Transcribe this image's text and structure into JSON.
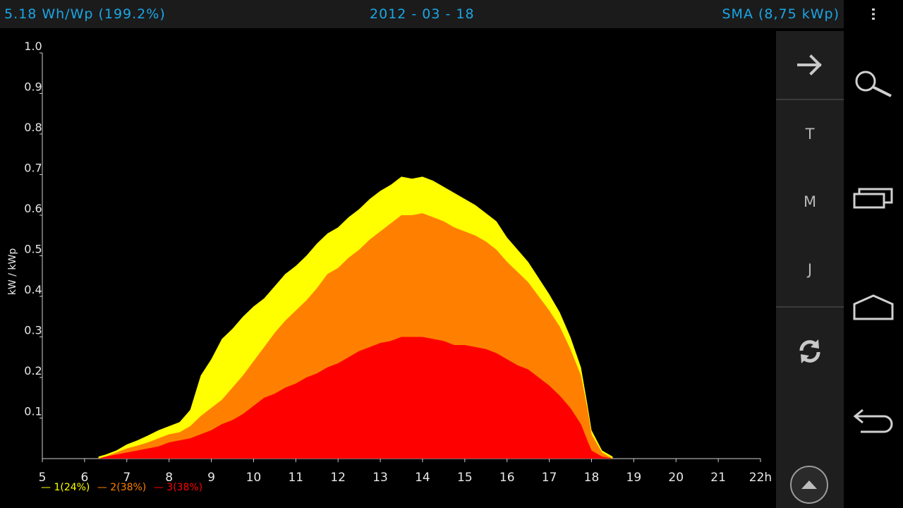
{
  "header": {
    "yield": "5.18 Wh/Wp (199.2%)",
    "date": "2012 - 03 - 18",
    "system": "SMA (8,75 kWp)"
  },
  "toolbar": {
    "forward_icon": "arrow-right-icon",
    "day_label": "T",
    "month_label": "M",
    "year_label": "J",
    "refresh_icon": "refresh-icon",
    "collapse_icon": "triangle-up-icon"
  },
  "nav": {
    "menu_icon": "overflow-menu-icon",
    "search_icon": "search-icon",
    "recent_icon": "recent-apps-icon",
    "home_icon": "home-icon",
    "back_icon": "back-icon"
  },
  "colors": {
    "accent": "#1ba6e6",
    "series1": "#ffff00",
    "series2": "#ff8000",
    "series3": "#ff0000"
  },
  "legend": [
    {
      "text": "— 1(24%)",
      "color": "#ffff00"
    },
    {
      "text": "— 2(38%)",
      "color": "#ff8000"
    },
    {
      "text": "— 3(38%)",
      "color": "#ff0000"
    }
  ],
  "chart_data": {
    "type": "area",
    "stacked": true,
    "ylabel": "kW / kWp",
    "xlabel": "",
    "xlim": [
      5,
      22
    ],
    "ylim": [
      0,
      1.0
    ],
    "x_tick_labels": [
      "5",
      "6",
      "7",
      "8",
      "9",
      "10",
      "11",
      "12",
      "13",
      "14",
      "15",
      "16",
      "17",
      "18",
      "19",
      "20",
      "21",
      "22h"
    ],
    "y_tick_labels": [
      "0.1",
      "0.2",
      "0.3",
      "0.4",
      "0.5",
      "0.6",
      "0.7",
      "0.8",
      "0.9",
      "1.0"
    ],
    "x": [
      6.33,
      6.5,
      6.75,
      7.0,
      7.25,
      7.5,
      7.75,
      8.0,
      8.25,
      8.5,
      8.75,
      9.0,
      9.25,
      9.5,
      9.75,
      10.0,
      10.25,
      10.5,
      10.75,
      11.0,
      11.25,
      11.5,
      11.75,
      12.0,
      12.25,
      12.5,
      12.75,
      13.0,
      13.25,
      13.5,
      13.75,
      14.0,
      14.25,
      14.5,
      14.75,
      15.0,
      15.25,
      15.5,
      15.75,
      16.0,
      16.25,
      16.5,
      16.75,
      17.0,
      17.25,
      17.5,
      17.75,
      17.9,
      18.0,
      18.25,
      18.5
    ],
    "series": [
      {
        "name": "3",
        "color": "#ff0000",
        "values": [
          0.0,
          0.005,
          0.01,
          0.015,
          0.02,
          0.025,
          0.03,
          0.04,
          0.045,
          0.05,
          0.06,
          0.07,
          0.085,
          0.095,
          0.11,
          0.13,
          0.15,
          0.16,
          0.175,
          0.185,
          0.2,
          0.21,
          0.225,
          0.235,
          0.25,
          0.265,
          0.275,
          0.285,
          0.29,
          0.3,
          0.3,
          0.3,
          0.295,
          0.29,
          0.28,
          0.28,
          0.275,
          0.27,
          0.26,
          0.245,
          0.23,
          0.22,
          0.2,
          0.18,
          0.155,
          0.125,
          0.085,
          0.045,
          0.02,
          0.005,
          0.0
        ]
      },
      {
        "name": "2",
        "color": "#ff8000",
        "values": [
          0.0,
          0.0,
          0.005,
          0.01,
          0.012,
          0.015,
          0.02,
          0.02,
          0.02,
          0.03,
          0.045,
          0.055,
          0.06,
          0.08,
          0.095,
          0.11,
          0.125,
          0.15,
          0.165,
          0.18,
          0.19,
          0.21,
          0.23,
          0.235,
          0.245,
          0.25,
          0.265,
          0.275,
          0.29,
          0.3,
          0.3,
          0.305,
          0.3,
          0.295,
          0.29,
          0.28,
          0.275,
          0.265,
          0.255,
          0.24,
          0.23,
          0.215,
          0.2,
          0.185,
          0.17,
          0.145,
          0.12,
          0.08,
          0.04,
          0.01,
          0.0
        ]
      },
      {
        "name": "1",
        "color": "#ffff00",
        "values": [
          0.005,
          0.005,
          0.005,
          0.01,
          0.013,
          0.017,
          0.02,
          0.02,
          0.025,
          0.04,
          0.1,
          0.12,
          0.15,
          0.145,
          0.145,
          0.135,
          0.12,
          0.115,
          0.115,
          0.11,
          0.11,
          0.11,
          0.1,
          0.1,
          0.1,
          0.1,
          0.1,
          0.1,
          0.095,
          0.095,
          0.09,
          0.09,
          0.09,
          0.085,
          0.085,
          0.08,
          0.075,
          0.07,
          0.07,
          0.06,
          0.055,
          0.05,
          0.045,
          0.04,
          0.035,
          0.03,
          0.02,
          0.01,
          0.01,
          0.005,
          0.005
        ]
      }
    ]
  }
}
